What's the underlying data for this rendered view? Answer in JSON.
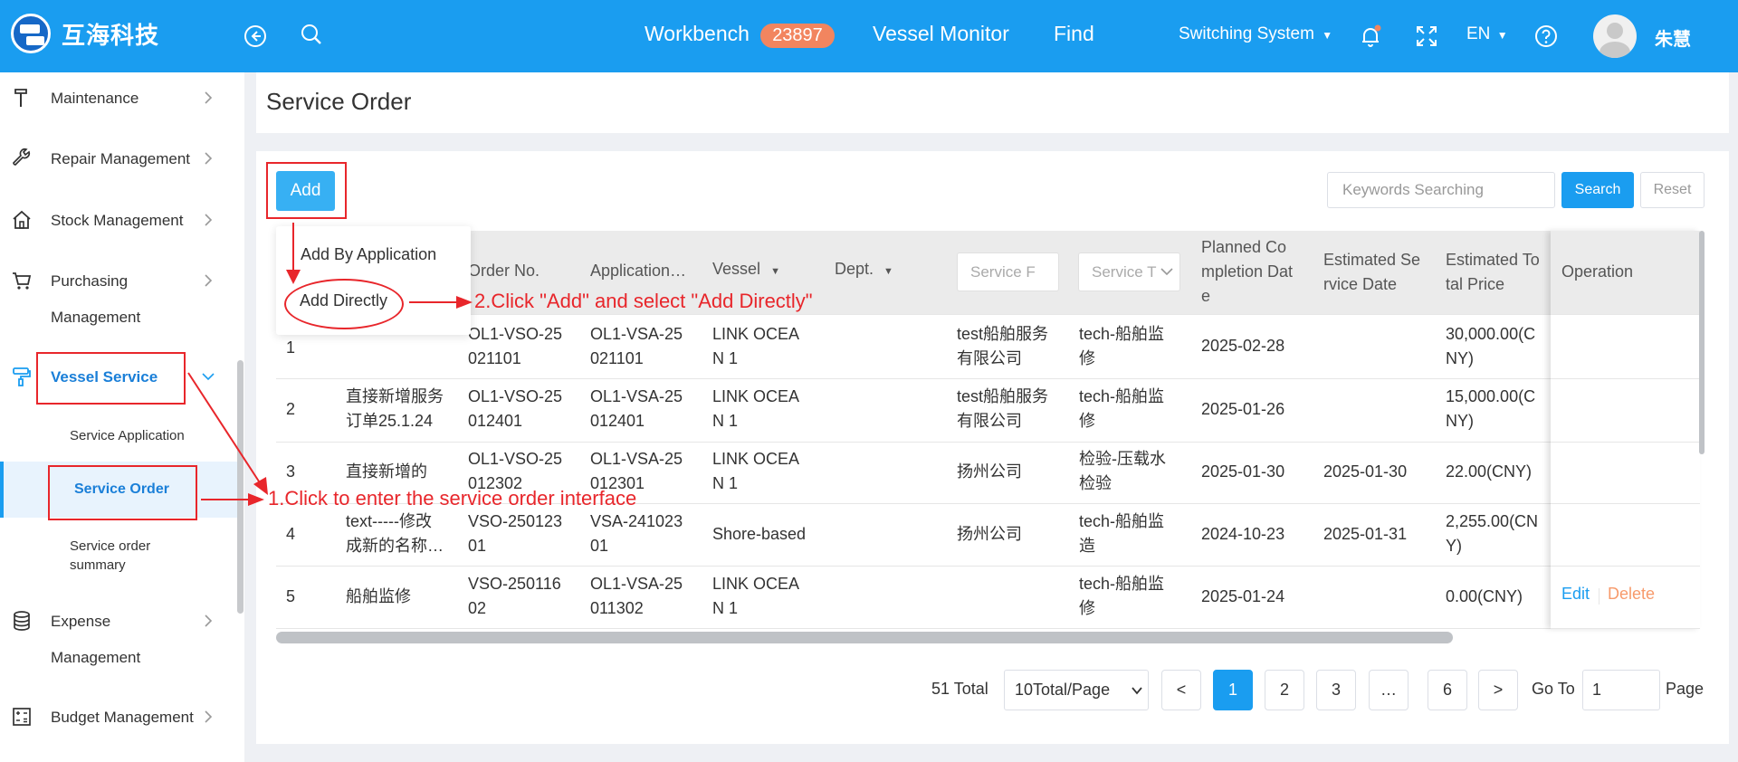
{
  "header": {
    "brand": "互海科技",
    "nav": [
      "Workbench",
      "Vessel Monitor",
      "Find"
    ],
    "workbench_badge": "23897",
    "switching_system": "Switching System",
    "language": "EN",
    "username": "朱慧",
    "brand_color": "#1a9df0"
  },
  "sidebar": {
    "items": [
      {
        "label": "Maintenance",
        "icon": "hammer-icon"
      },
      {
        "label": "Repair Management",
        "icon": "wrench-icon"
      },
      {
        "label": "Stock Management",
        "icon": "home-icon"
      },
      {
        "label": "Purchasing",
        "label2": "Management",
        "icon": "cart-icon"
      },
      {
        "label": "Vessel Service",
        "icon": "paint-roller-icon"
      },
      {
        "label": "Expense",
        "label2": "Management",
        "icon": "database-icon"
      },
      {
        "label": "Budget Management",
        "icon": "calculator-icon"
      }
    ],
    "sub_items": [
      "Service Application",
      "Service Order",
      "Service order",
      "summary"
    ]
  },
  "page": {
    "title": "Service Order",
    "add_button": "Add",
    "search_placeholder": "Keywords Searching",
    "search_button": "Search",
    "reset_button": "Reset"
  },
  "dropdown": {
    "items": [
      "Add By Application",
      "Add Directly"
    ]
  },
  "table": {
    "headers": {
      "order_no": "Order No.",
      "application": "Application…",
      "vessel": "Vessel",
      "dept": "Dept.",
      "service_provider_filter": "Service F",
      "service_type_filter": "Service T",
      "planned_1": "Planned Co",
      "planned_2": "mpletion Dat",
      "planned_3": "e",
      "est_date_1": "Estimated Se",
      "est_date_2": "rvice Date",
      "est_price_1": "Estimated To",
      "est_price_2": "tal Price",
      "operation": "Operation"
    },
    "rows": [
      {
        "no": "1",
        "name1": "",
        "name2": "",
        "order1": "OL1-VSO-25",
        "order2": "021101",
        "app1": "OL1-VSA-25",
        "app2": "021101",
        "vessel1": "LINK OCEA",
        "vessel2": "N 1",
        "provider1": "test船舶服务",
        "provider2": "有限公司",
        "type1": "tech-船舶监",
        "type2": "修",
        "planned": "2025-02-28",
        "est_date": "",
        "price1": "30,000.00(C",
        "price2": "NY)"
      },
      {
        "no": "2",
        "name1": "直接新增服务",
        "name2": "订单25.1.24",
        "order1": "OL1-VSO-25",
        "order2": "012401",
        "app1": "OL1-VSA-25",
        "app2": "012401",
        "vessel1": "LINK OCEA",
        "vessel2": "N 1",
        "provider1": "test船舶服务",
        "provider2": "有限公司",
        "type1": "tech-船舶监",
        "type2": "修",
        "planned": "2025-01-26",
        "est_date": "",
        "price1": "15,000.00(C",
        "price2": "NY)"
      },
      {
        "no": "3",
        "name1": "直接新增的",
        "name2": "",
        "order1": "OL1-VSO-25",
        "order2": "012302",
        "app1": "OL1-VSA-25",
        "app2": "012301",
        "vessel1": "LINK OCEA",
        "vessel2": "N 1",
        "provider1": "扬州公司",
        "provider2": "",
        "type1": "检验-压载水",
        "type2": "检验",
        "planned": "2025-01-30",
        "est_date": "2025-01-30",
        "price1": "22.00(CNY)",
        "price2": ""
      },
      {
        "no": "4",
        "name1": "text-----修改",
        "name2": "成新的名称…",
        "order1": "VSO-250123",
        "order2": "01",
        "app1": "VSA-241023",
        "app2": "01",
        "vessel1": "Shore-based",
        "vessel2": "",
        "provider1": "扬州公司",
        "provider2": "",
        "type1": "tech-船舶监",
        "type2": "造",
        "planned": "2024-10-23",
        "est_date": "2025-01-31",
        "price1": "2,255.00(CN",
        "price2": "Y)"
      },
      {
        "no": "5",
        "name1": "船舶监修",
        "name2": "",
        "order1": "VSO-250116",
        "order2": "02",
        "app1": "OL1-VSA-25",
        "app2": "011302",
        "vessel1": "LINK OCEA",
        "vessel2": "N 1",
        "provider1": "",
        "provider2": "",
        "type1": "tech-船舶监",
        "type2": "修",
        "planned": "2025-01-24",
        "est_date": "",
        "price1": "0.00(CNY)",
        "price2": ""
      }
    ],
    "edit": "Edit",
    "delete": "Delete"
  },
  "pagination": {
    "total": "51 Total",
    "page_size": "10Total/Page",
    "prev": "<",
    "pages": [
      "1",
      "2",
      "3",
      "…",
      "6"
    ],
    "next": ">",
    "goto_label": "Go To",
    "goto_value": "1",
    "page_label": "Page"
  },
  "annotations": {
    "step1": "1.Click to enter the service order interface",
    "step2": "2.Click \"Add\" and select \"Add Directly\"",
    "color": "#e8262b"
  }
}
